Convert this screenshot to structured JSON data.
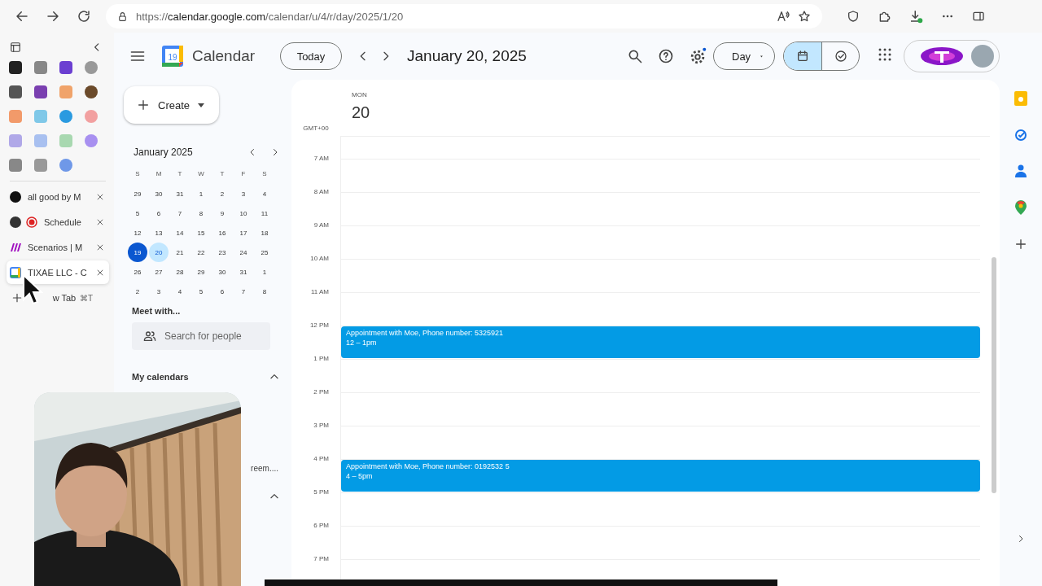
{
  "browser": {
    "url": "https://**calendar.google.com**/calendar/u/4/r/day/2025/1/20",
    "tabs": [
      {
        "title": "all good by M",
        "selected": false
      },
      {
        "title": "Schedule",
        "selected": false
      },
      {
        "title": "Scenarios | M",
        "selected": false
      },
      {
        "title": "TIXAE LLC - C",
        "selected": true
      }
    ],
    "new_tab": {
      "label": "w Tab",
      "shortcut": "⌘T"
    }
  },
  "calendar": {
    "app_name": "Calendar",
    "logo_day": "19",
    "today_button": "Today",
    "date_title": "January 20, 2025",
    "view": "Day",
    "view_toggle": [
      {
        "selected": true
      },
      {
        "selected": false
      }
    ],
    "create": "Create",
    "mini_calendar": {
      "month": "January 2025",
      "weekdays": [
        "S",
        "M",
        "T",
        "W",
        "T",
        "F",
        "S"
      ],
      "weeks": [
        [
          {
            "day": "29",
            "today": false,
            "selected": false
          },
          {
            "day": "30",
            "today": false,
            "selected": false
          },
          {
            "day": "31",
            "today": false,
            "selected": false
          },
          {
            "day": "1",
            "today": false,
            "selected": false
          },
          {
            "day": "2",
            "today": false,
            "selected": false
          },
          {
            "day": "3",
            "today": false,
            "selected": false
          },
          {
            "day": "4",
            "today": false,
            "selected": false
          }
        ],
        [
          {
            "day": "5",
            "today": false,
            "selected": false
          },
          {
            "day": "6",
            "today": false,
            "selected": false
          },
          {
            "day": "7",
            "today": false,
            "selected": false
          },
          {
            "day": "8",
            "today": false,
            "selected": false
          },
          {
            "day": "9",
            "today": false,
            "selected": false
          },
          {
            "day": "10",
            "today": false,
            "selected": false
          },
          {
            "day": "11",
            "today": false,
            "selected": false
          }
        ],
        [
          {
            "day": "12",
            "today": false,
            "selected": false
          },
          {
            "day": "13",
            "today": false,
            "selected": false
          },
          {
            "day": "14",
            "today": false,
            "selected": false
          },
          {
            "day": "15",
            "today": false,
            "selected": false
          },
          {
            "day": "16",
            "today": false,
            "selected": false
          },
          {
            "day": "17",
            "today": false,
            "selected": false
          },
          {
            "day": "18",
            "today": false,
            "selected": false
          }
        ],
        [
          {
            "day": "19",
            "today": true,
            "selected": false
          },
          {
            "day": "20",
            "today": false,
            "selected": true
          },
          {
            "day": "21",
            "today": false,
            "selected": false
          },
          {
            "day": "22",
            "today": false,
            "selected": false
          },
          {
            "day": "23",
            "today": false,
            "selected": false
          },
          {
            "day": "24",
            "today": false,
            "selected": false
          },
          {
            "day": "25",
            "today": false,
            "selected": false
          }
        ],
        [
          {
            "day": "26",
            "today": false,
            "selected": false
          },
          {
            "day": "27",
            "today": false,
            "selected": false
          },
          {
            "day": "28",
            "today": false,
            "selected": false
          },
          {
            "day": "29",
            "today": false,
            "selected": false
          },
          {
            "day": "30",
            "today": false,
            "selected": false
          },
          {
            "day": "31",
            "today": false,
            "selected": false
          },
          {
            "day": "1",
            "today": false,
            "selected": false
          }
        ],
        [
          {
            "day": "2",
            "today": false,
            "selected": false
          },
          {
            "day": "3",
            "today": false,
            "selected": false
          },
          {
            "day": "4",
            "today": false,
            "selected": false
          },
          {
            "day": "5",
            "today": false,
            "selected": false
          },
          {
            "day": "6",
            "today": false,
            "selected": false
          },
          {
            "day": "7",
            "today": false,
            "selected": false
          },
          {
            "day": "8",
            "today": false,
            "selected": false
          }
        ]
      ]
    },
    "meet_with": {
      "title": "Meet with...",
      "placeholder": "Search for people"
    },
    "my_calendars": {
      "title": "My calendars",
      "expanded": true
    },
    "other_calendars": {
      "item": "reem....",
      "expanded": true
    },
    "day_column": {
      "weekday": "MON",
      "date": "20",
      "timezone": "GMT+00"
    },
    "hours": [
      {
        "label": "7 AM"
      },
      {
        "label": "8 AM"
      },
      {
        "label": "9 AM"
      },
      {
        "label": "10 AM"
      },
      {
        "label": "11 AM"
      },
      {
        "label": "12 PM",
        "events": [
          {
            "title": "Appointment with Moe, Phone number: 5325921",
            "time": "12 – 1pm"
          }
        ]
      },
      {
        "label": "1 PM"
      },
      {
        "label": "2 PM"
      },
      {
        "label": "3 PM"
      },
      {
        "label": "4 PM",
        "events": [
          {
            "title": "Appointment with Moe, Phone number: 0192532 5",
            "time": "4 – 5pm"
          }
        ]
      },
      {
        "label": "5 PM"
      },
      {
        "label": "6 PM"
      },
      {
        "label": "7 PM"
      }
    ]
  }
}
